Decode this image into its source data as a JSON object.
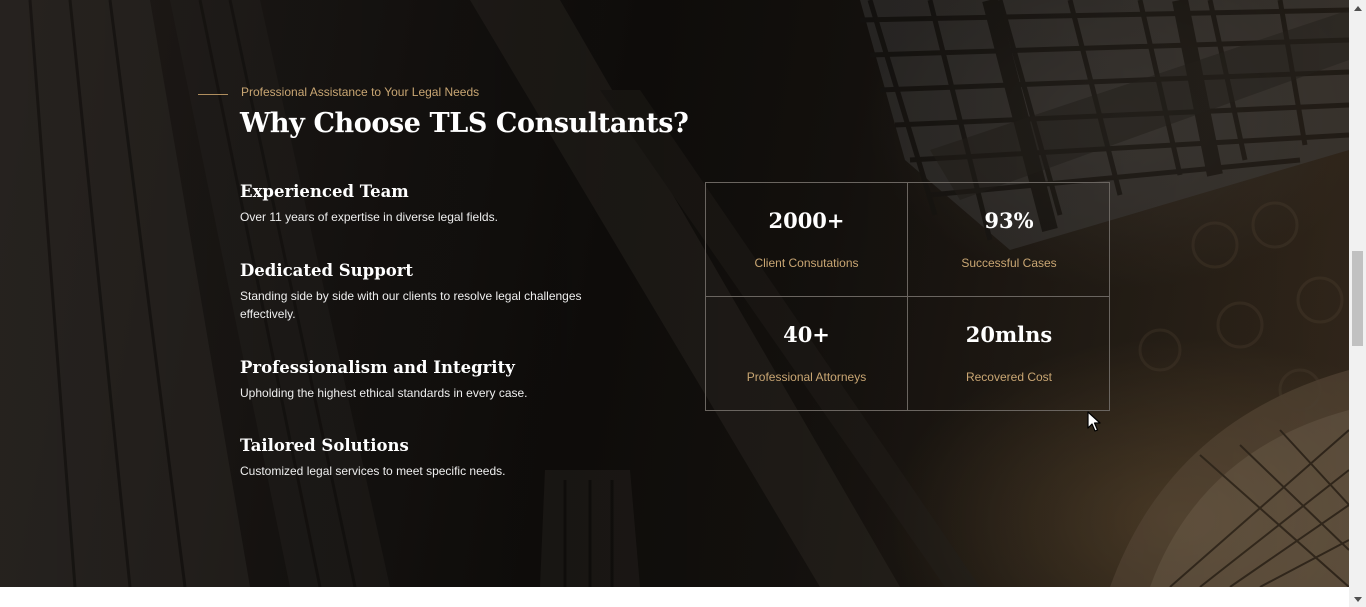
{
  "section": {
    "eyebrow": "Professional Assistance to Your Legal Needs",
    "title": "Why Choose TLS Consultants?"
  },
  "features": [
    {
      "title": "Experienced Team",
      "text": "Over 11 years of expertise in diverse legal fields."
    },
    {
      "title": "Dedicated Support",
      "text": "Standing side by side with our clients to resolve legal challenges effectively."
    },
    {
      "title": "Professionalism and Integrity",
      "text": "Upholding the highest ethical standards in every case."
    },
    {
      "title": "Tailored Solutions",
      "text": "Customized legal services to meet specific needs."
    }
  ],
  "stats": [
    {
      "value": "2000+",
      "label": "Client Consutations"
    },
    {
      "value": "93%",
      "label": "Successful Cases"
    },
    {
      "value": "40+",
      "label": "Professional Attorneys"
    },
    {
      "value": "20mlns",
      "label": "Recovered Cost"
    }
  ],
  "colors": {
    "accent": "#c9a673",
    "heading": "#ffffff",
    "body_text": "#eeeeee",
    "grid_border": "#6a6560"
  },
  "scrollbar": {
    "position_fraction": 0.49
  }
}
